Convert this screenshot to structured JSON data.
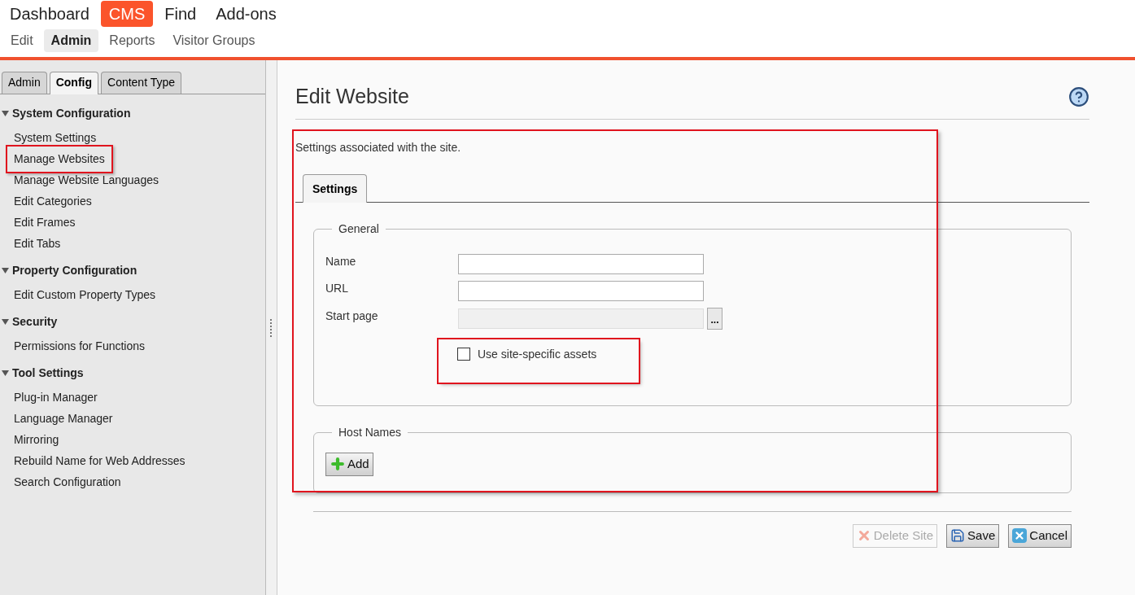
{
  "top_nav": [
    {
      "label": "Dashboard",
      "selected": false
    },
    {
      "label": "CMS",
      "selected": true
    },
    {
      "label": "Find",
      "selected": false
    },
    {
      "label": "Add-ons",
      "selected": false
    }
  ],
  "sub_nav": [
    {
      "label": "Edit",
      "selected": false
    },
    {
      "label": "Admin",
      "selected": true
    },
    {
      "label": "Reports",
      "selected": false
    },
    {
      "label": "Visitor Groups",
      "selected": false
    }
  ],
  "sidebar": {
    "tabs": [
      {
        "label": "Admin",
        "selected": false
      },
      {
        "label": "Config",
        "selected": true
      },
      {
        "label": "Content Type",
        "selected": false
      }
    ],
    "sections": [
      {
        "title": "System Configuration",
        "expanded": true,
        "items": [
          {
            "label": "System Settings",
            "highlighted": false
          },
          {
            "label": "Manage Websites",
            "highlighted": true
          },
          {
            "label": "Manage Website Languages",
            "highlighted": false
          },
          {
            "label": "Edit Categories",
            "highlighted": false
          },
          {
            "label": "Edit Frames",
            "highlighted": false
          },
          {
            "label": "Edit Tabs",
            "highlighted": false
          }
        ]
      },
      {
        "title": "Property Configuration",
        "expanded": true,
        "items": [
          {
            "label": "Edit Custom Property Types",
            "highlighted": false
          }
        ]
      },
      {
        "title": "Security",
        "expanded": true,
        "items": [
          {
            "label": "Permissions for Functions",
            "highlighted": false
          }
        ]
      },
      {
        "title": "Tool Settings",
        "expanded": true,
        "items": [
          {
            "label": "Plug-in Manager",
            "highlighted": false
          },
          {
            "label": "Language Manager",
            "highlighted": false
          },
          {
            "label": "Mirroring",
            "highlighted": false
          },
          {
            "label": "Rebuild Name for Web Addresses",
            "highlighted": false
          },
          {
            "label": "Search Configuration",
            "highlighted": false
          }
        ]
      }
    ]
  },
  "main": {
    "title": "Edit Website",
    "description": "Settings associated with the site.",
    "tabs": [
      {
        "label": "Settings",
        "selected": true
      }
    ],
    "general": {
      "legend": "General",
      "fields": [
        {
          "label": "Name",
          "disabled": false
        },
        {
          "label": "URL",
          "disabled": false
        },
        {
          "label": "Start page",
          "disabled": true,
          "browse": "..."
        }
      ],
      "checkbox": {
        "label": "Use site-specific assets",
        "checked": false,
        "highlighted": true
      }
    },
    "host_names": {
      "legend": "Host Names",
      "add_button": "Add"
    },
    "buttons": [
      {
        "kind": "delete",
        "label": "Delete Site",
        "disabled": true
      },
      {
        "kind": "save",
        "label": "Save",
        "disabled": false
      },
      {
        "kind": "cancel",
        "label": "Cancel",
        "disabled": false
      }
    ]
  }
}
